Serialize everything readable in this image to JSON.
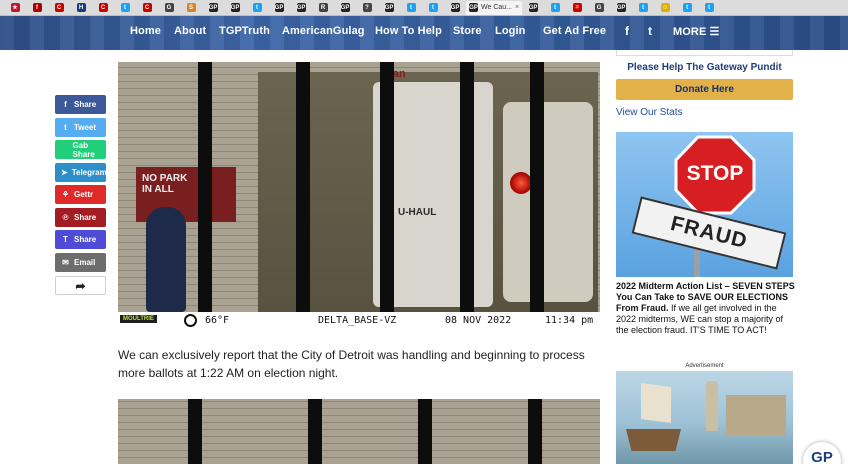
{
  "browser": {
    "tabs": [
      {
        "label": "",
        "color": "#c8102e",
        "glyph": "★"
      },
      {
        "label": "",
        "color": "#b00000",
        "glyph": "f"
      },
      {
        "label": "",
        "color": "#cc0000",
        "glyph": "C"
      },
      {
        "label": "",
        "color": "#1a3a80",
        "glyph": "H"
      },
      {
        "label": "",
        "color": "#cc0000",
        "glyph": "C"
      },
      {
        "label": "",
        "color": "#1da1f2",
        "glyph": "t"
      },
      {
        "label": "",
        "color": "#cc0000",
        "glyph": "C"
      },
      {
        "label": "",
        "color": "#444444",
        "glyph": "G"
      },
      {
        "label": "",
        "color": "#d9822b",
        "glyph": "S"
      },
      {
        "label": "",
        "color": "#222222",
        "glyph": "GP"
      },
      {
        "label": "",
        "color": "#222222",
        "glyph": "GP"
      },
      {
        "label": "",
        "color": "#1da1f2",
        "glyph": "t"
      },
      {
        "label": "",
        "color": "#222222",
        "glyph": "GP"
      },
      {
        "label": "",
        "color": "#222222",
        "glyph": "GP"
      },
      {
        "label": "",
        "color": "#444444",
        "glyph": "R"
      },
      {
        "label": "",
        "color": "#222222",
        "glyph": "GP"
      },
      {
        "label": "",
        "color": "#444444",
        "glyph": "?"
      },
      {
        "label": "",
        "color": "#222222",
        "glyph": "GP"
      },
      {
        "label": "",
        "color": "#1da1f2",
        "glyph": "t"
      },
      {
        "label": "",
        "color": "#1da1f2",
        "glyph": "t"
      },
      {
        "label": "",
        "color": "#222222",
        "glyph": "GP"
      }
    ],
    "active_tab": {
      "label": "We Cau...",
      "glyph": "GP"
    },
    "tabs_right": [
      {
        "color": "#222222",
        "glyph": "GP"
      },
      {
        "color": "#1da1f2",
        "glyph": "t"
      },
      {
        "color": "#cc0000",
        "glyph": "="
      },
      {
        "color": "#444444",
        "glyph": "G"
      },
      {
        "color": "#222222",
        "glyph": "GP"
      },
      {
        "color": "#1da1f2",
        "glyph": "t"
      },
      {
        "color": "#e0b000",
        "glyph": "☺"
      },
      {
        "color": "#1da1f2",
        "glyph": "t"
      },
      {
        "color": "#1da1f2",
        "glyph": "t"
      }
    ]
  },
  "nav": {
    "items": [
      "Home",
      "About",
      "TGPTruth",
      "AmericanGulag",
      "How To Help",
      "Store",
      "Login",
      "Get Ad Free"
    ],
    "facebook": "f",
    "twitter": "t",
    "more": "MORE ☰"
  },
  "share": [
    {
      "label": "Share",
      "icon": "f",
      "color": "#3b5998"
    },
    {
      "label": "Tweet",
      "icon": "t",
      "color": "#55acee"
    },
    {
      "label": "Gab Share",
      "icon": "",
      "color": "#21cf7a"
    },
    {
      "label": "Telegram",
      "icon": "➤",
      "color": "#2c8fc9"
    },
    {
      "label": "Gettr",
      "icon": "⚘",
      "color": "#e02a2a"
    },
    {
      "label": "Share",
      "icon": "℗",
      "color": "#a31b23"
    },
    {
      "label": "Share",
      "icon": "T",
      "color": "#4e4bd6"
    },
    {
      "label": "Email",
      "icon": "✉",
      "color": "#6d6d6d"
    },
    {
      "label": "",
      "icon": "➦",
      "color": "#ffffff"
    }
  ],
  "camera": {
    "brand": "MOULTRIE",
    "temp": "66°F",
    "location": "DELTA_BASE-VZ",
    "date": "08 NOV 2022",
    "time": "11:34 pm"
  },
  "photo_signs": {
    "no_parking": "NO PARK\nIN ALL",
    "van": "Van",
    "uhaul": "U-HAUL"
  },
  "article": {
    "paragraph": "We can exclusively report that the City of Detroit was handling and beginning to process more ballots at 1:22 AM on election night."
  },
  "sidebar": {
    "help_title": "Please Help The Gateway Pundit",
    "donate": "Donate Here",
    "stats": "View Our Stats",
    "stop_sign": "STOP",
    "fraud_sign": "FRAUD",
    "promo_bold": "2022 Midterm Action List – SEVEN STEPS You Can Take to SAVE OUR ELECTIONS From Fraud.",
    "promo_text": " If we all get involved in the 2022 midterms, WE can stop a majority of the election fraud. IT'S TIME TO ACT!",
    "advertisement": "Advertisement"
  },
  "badge": "GP"
}
